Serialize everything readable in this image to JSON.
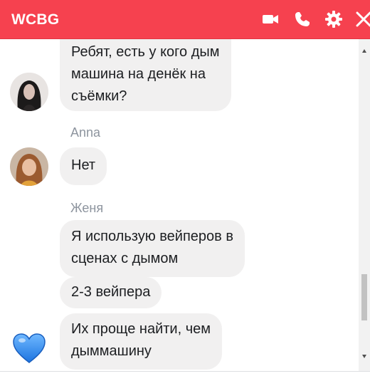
{
  "header": {
    "title": "WCBG",
    "icons": [
      "video-camera-icon",
      "phone-icon",
      "gear-icon",
      "close-icon"
    ]
  },
  "messages": [
    {
      "text": "Ребят, есть у кого дым\nмашина на денёк на\nсъёмки?"
    },
    {
      "sender": "Anna",
      "text": "Нет"
    },
    {
      "sender": "Женя",
      "text": "Я использую вейперов в\nсценах с дымом"
    },
    {
      "text": "2-3 вейпера"
    },
    {
      "text": "Их проще найти, чем\nдыммашину"
    }
  ],
  "colors": {
    "header": "#f6414f",
    "bubble": "#f1f0f0",
    "sender_name": "#8d949e",
    "heart": "#2f8ff0"
  }
}
